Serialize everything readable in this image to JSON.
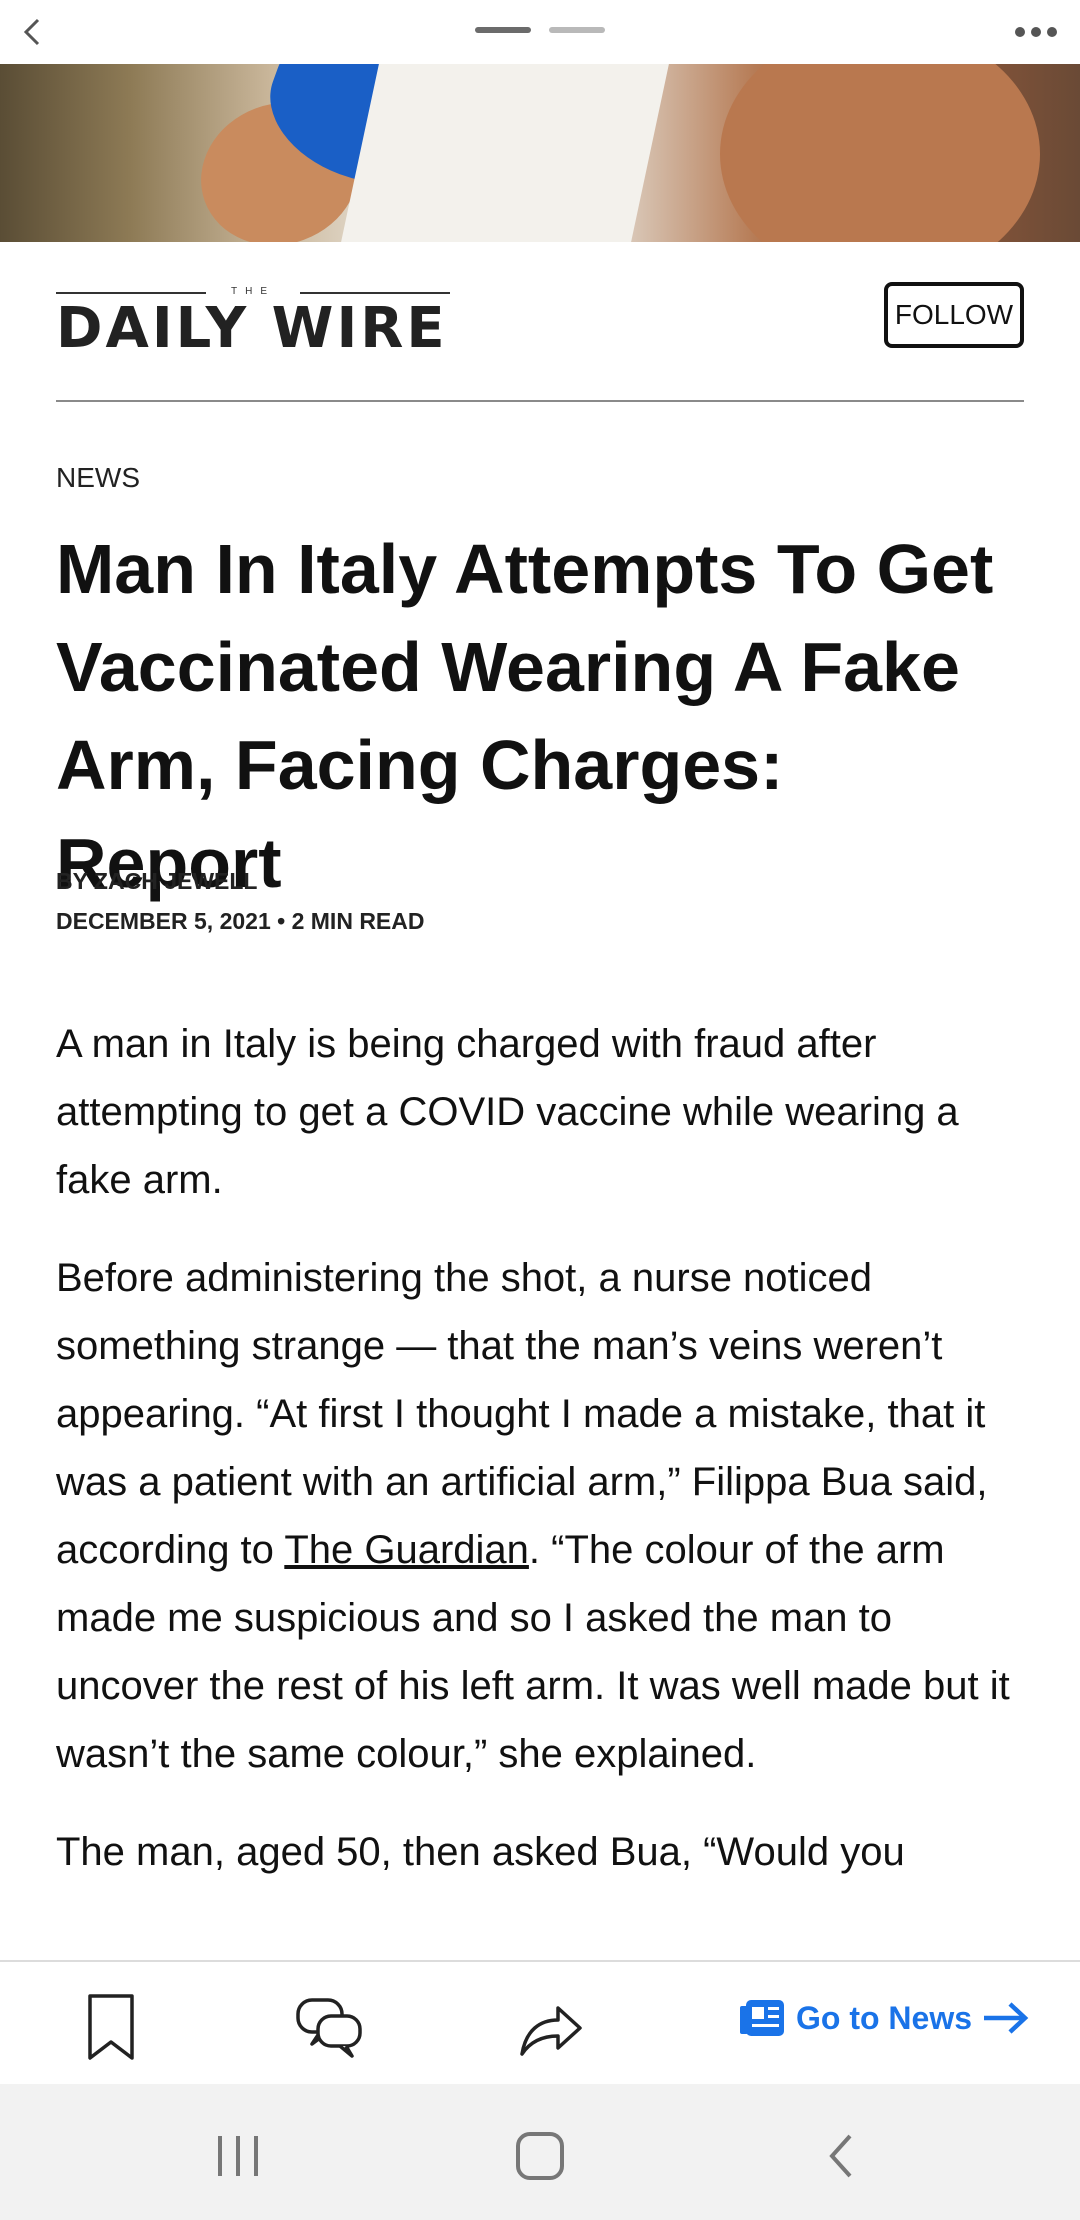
{
  "topbar": {
    "page_count": 2,
    "active_page": 1
  },
  "publisher": {
    "logo_small": "THE",
    "logo_text": "DAILY WIRE",
    "follow_label": "FOLLOW"
  },
  "article": {
    "section": "NEWS",
    "headline": "Man In Italy Attempts To Get Vaccinated Wearing A Fake Arm, Facing Charges: Report",
    "byline": "BY ZACH JEWELL",
    "dateline": "DECEMBER 5, 2021 • 2 MIN READ",
    "paragraph_1": "A man in Italy is being charged with fraud after attempting to get a COVID vaccine while wearing a fake arm.",
    "paragraph_2_before_link": "Before administering the shot, a nurse noticed something strange — that the man’s veins weren’t appearing. “At first I thought I made a mistake, that it was a patient with an artificial arm,” Filippa Bua said, according to ",
    "paragraph_2_link": "The Guardian",
    "paragraph_2_after_link": ". “The colour of the arm made me suspicious and so I asked the man to uncover the rest of his left arm. It was well made but it wasn’t the same colour,” she explained.",
    "paragraph_3": "The man, aged 50, then asked Bua, “Would you"
  },
  "actionbar": {
    "goto_label": "Go to News",
    "accent_color": "#1a73e8"
  }
}
